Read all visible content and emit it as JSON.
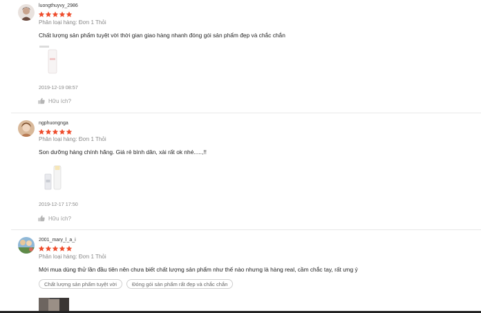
{
  "reviews": [
    {
      "username": "luongthuyvy_2986",
      "rating": 5,
      "variation": "Phân loại hàng: Đơn 1 Thỏi",
      "comment": "Chất lượng sản phẩm tuyệt vời thời gian giao hàng nhanh đóng gói sản phẩm đẹp và chắc chắn",
      "date": "2019-12-19 08:57",
      "helpful_label": "Hữu ích?"
    },
    {
      "username": "ngphuongnga",
      "rating": 5,
      "variation": "Phân loại hàng: Đơn 1 Thỏi",
      "comment": "Son dưỡng hàng chính hãng. Giá rẻ bình dân, xài rất ok nhé.....,!!",
      "date": "2019-12-17 17:50",
      "helpful_label": "Hữu ích?"
    },
    {
      "username": "2001_mary_l_a_i",
      "rating": 5,
      "variation": "Phân loại hàng: Đơn 1 Thỏi",
      "comment": "Mới mua dùng thử lần đầu tiên nên chưa biết chất lượng sản phẩm như thế nào nhưng là hàng real, cầm chắc tay, rất ưng ý",
      "tags": [
        "Chất lượng sản phẩm tuyệt vời",
        "Đóng gói sản phẩm rất đẹp và chắc chắn"
      ]
    }
  ],
  "colors": {
    "star": "#ee4d2d",
    "muted_text": "#888888",
    "divider": "#e8e8e8"
  },
  "icons": {
    "star": "star-icon",
    "helpful": "thumbs-up-icon"
  }
}
